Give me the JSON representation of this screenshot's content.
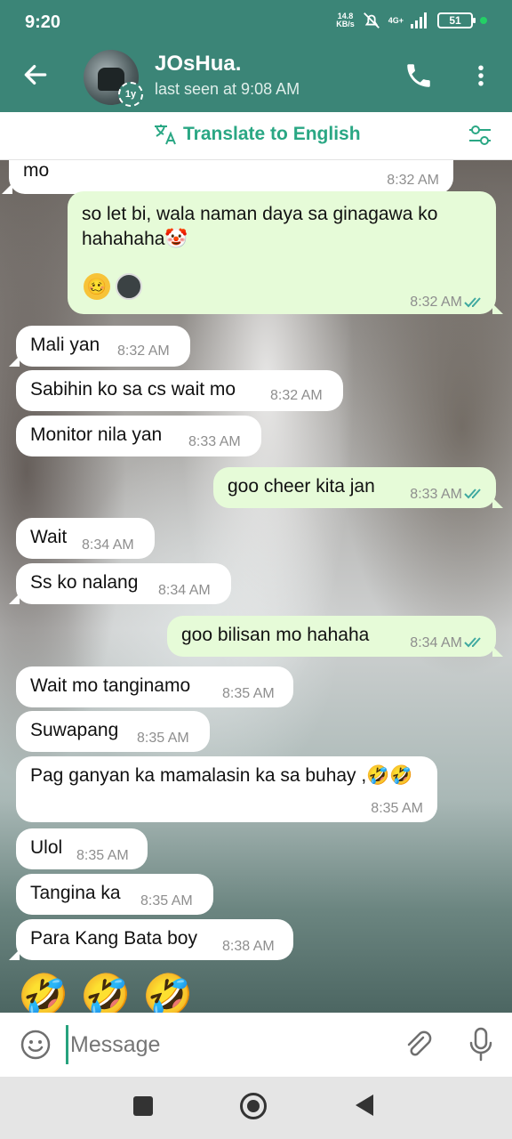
{
  "status_bar": {
    "time": "9:20",
    "net_speed_value": "14.8",
    "net_speed_unit": "KB/s",
    "signal": "4G+",
    "battery": "51"
  },
  "header": {
    "contact_name": "JOsHua.",
    "last_seen": "last seen at 9:08 AM",
    "story_badge": "1y"
  },
  "translate_bar": {
    "label": "Translate to English"
  },
  "messages": [
    {
      "dir": "in",
      "text": "mo",
      "time": "8:32 AM"
    },
    {
      "dir": "out",
      "text": "so let bi, wala naman daya sa ginagawa ko hahahaha🤡",
      "time": "8:32 AM",
      "reaction": "🥴"
    },
    {
      "dir": "in",
      "text": "Mali yan",
      "time": "8:32 AM"
    },
    {
      "dir": "in",
      "text": "Sabihin ko sa cs wait mo",
      "time": "8:32 AM"
    },
    {
      "dir": "in",
      "text": "Monitor nila yan",
      "time": "8:33 AM"
    },
    {
      "dir": "out",
      "text": "goo cheer kita jan",
      "time": "8:33 AM"
    },
    {
      "dir": "in",
      "text": "Wait",
      "time": "8:34 AM"
    },
    {
      "dir": "in",
      "text": "Ss ko nalang",
      "time": "8:34 AM"
    },
    {
      "dir": "out",
      "text": "goo bilisan mo hahaha",
      "time": "8:34 AM"
    },
    {
      "dir": "in",
      "text": "Wait mo tanginamo",
      "time": "8:35 AM"
    },
    {
      "dir": "in",
      "text": "Suwapang",
      "time": "8:35 AM"
    },
    {
      "dir": "in",
      "text": "Pag ganyan ka mamalasin ka sa buhay ,🤣🤣",
      "time": "8:35 AM"
    },
    {
      "dir": "in",
      "text": "Ulol",
      "time": "8:35 AM"
    },
    {
      "dir": "in",
      "text": "Tangina ka",
      "time": "8:35 AM"
    },
    {
      "dir": "in",
      "text": "Para Kang Bata boy",
      "time": "8:38 AM"
    }
  ],
  "last_message_emojis": "🤣 🤣 🤣",
  "composer": {
    "placeholder": "Message"
  },
  "colors": {
    "header": "#3b8577",
    "accent": "#2aa784",
    "outgoing_bubble": "#e6fbd8",
    "incoming_bubble": "#ffffff",
    "read_ticks": "#3fa9a0"
  }
}
